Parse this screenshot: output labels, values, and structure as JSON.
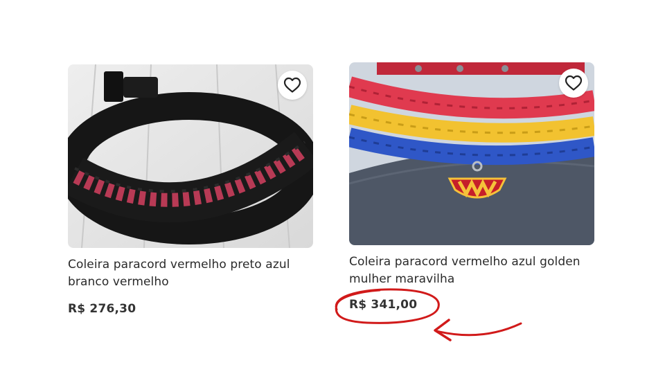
{
  "products": [
    {
      "title": "Coleira paracord vermelho preto azul branco vermelho",
      "price": "R$ 276,30",
      "favorite_icon": "heart-icon"
    },
    {
      "title": "Coleira paracord vermelho azul golden mulher maravilha",
      "price": "R$ 341,00",
      "favorite_icon": "heart-icon"
    }
  ],
  "annotation": {
    "color": "#d11a1a",
    "target": "price-of-second-product"
  }
}
